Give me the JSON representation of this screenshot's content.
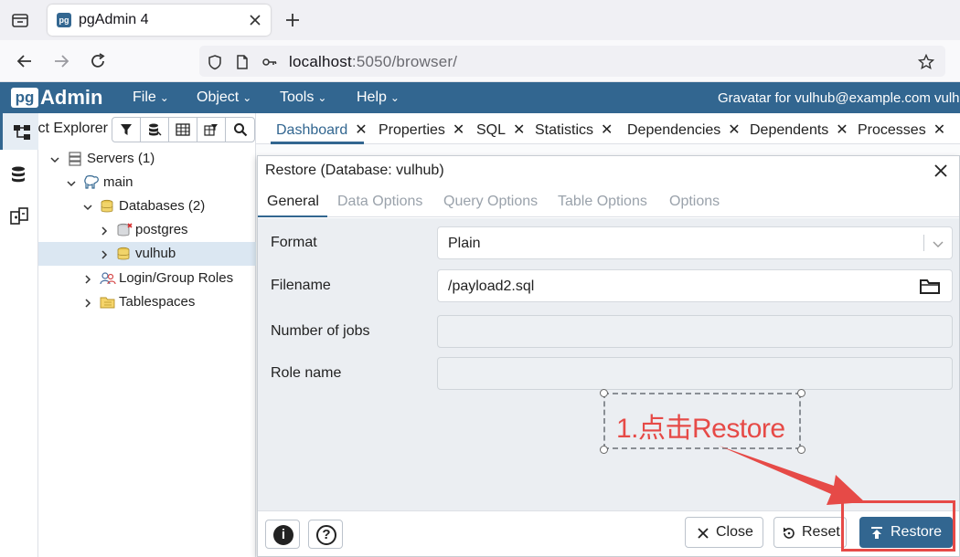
{
  "browser": {
    "tab_title": "pgAdmin 4",
    "favicon_text": "pg",
    "url_host": "localhost",
    "url_rest": ":5050/browser/"
  },
  "app": {
    "logo_pg": "pg",
    "logo_admin": "Admin",
    "menus": [
      "File",
      "Object",
      "Tools",
      "Help"
    ],
    "gravatar": "Gravatar for vulhub@example.com vulh",
    "brand_color": "#326690"
  },
  "explorer": {
    "title": "Object Explorer",
    "tree": [
      {
        "label": "Servers",
        "count": "(1)"
      },
      {
        "label": "main",
        "count": ""
      },
      {
        "label": "Databases",
        "count": "(2)"
      },
      {
        "label": "postgres",
        "count": ""
      },
      {
        "label": "vulhub",
        "count": ""
      },
      {
        "label": "Login/Group Roles",
        "count": ""
      },
      {
        "label": "Tablespaces",
        "count": ""
      }
    ]
  },
  "main_tabs": [
    "Dashboard",
    "Properties",
    "SQL",
    "Statistics",
    "Dependencies",
    "Dependents",
    "Processes"
  ],
  "dialog": {
    "title": "Restore (Database: vulhub)",
    "tabs": [
      "General",
      "Data Options",
      "Query Options",
      "Table Options",
      "Options"
    ],
    "fields": {
      "format_label": "Format",
      "format_value": "Plain",
      "filename_label": "Filename",
      "filename_value": "/payload2.sql",
      "jobs_label": "Number of jobs",
      "jobs_value": "",
      "role_label": "Role name",
      "role_value": ""
    },
    "footer": {
      "info_symbol": "i",
      "help_symbol": "?",
      "close_label": "Close",
      "reset_label": "Reset",
      "restore_label": "Restore"
    }
  },
  "annotation": {
    "text": "1.点击Restore",
    "color": "#e64a47"
  }
}
